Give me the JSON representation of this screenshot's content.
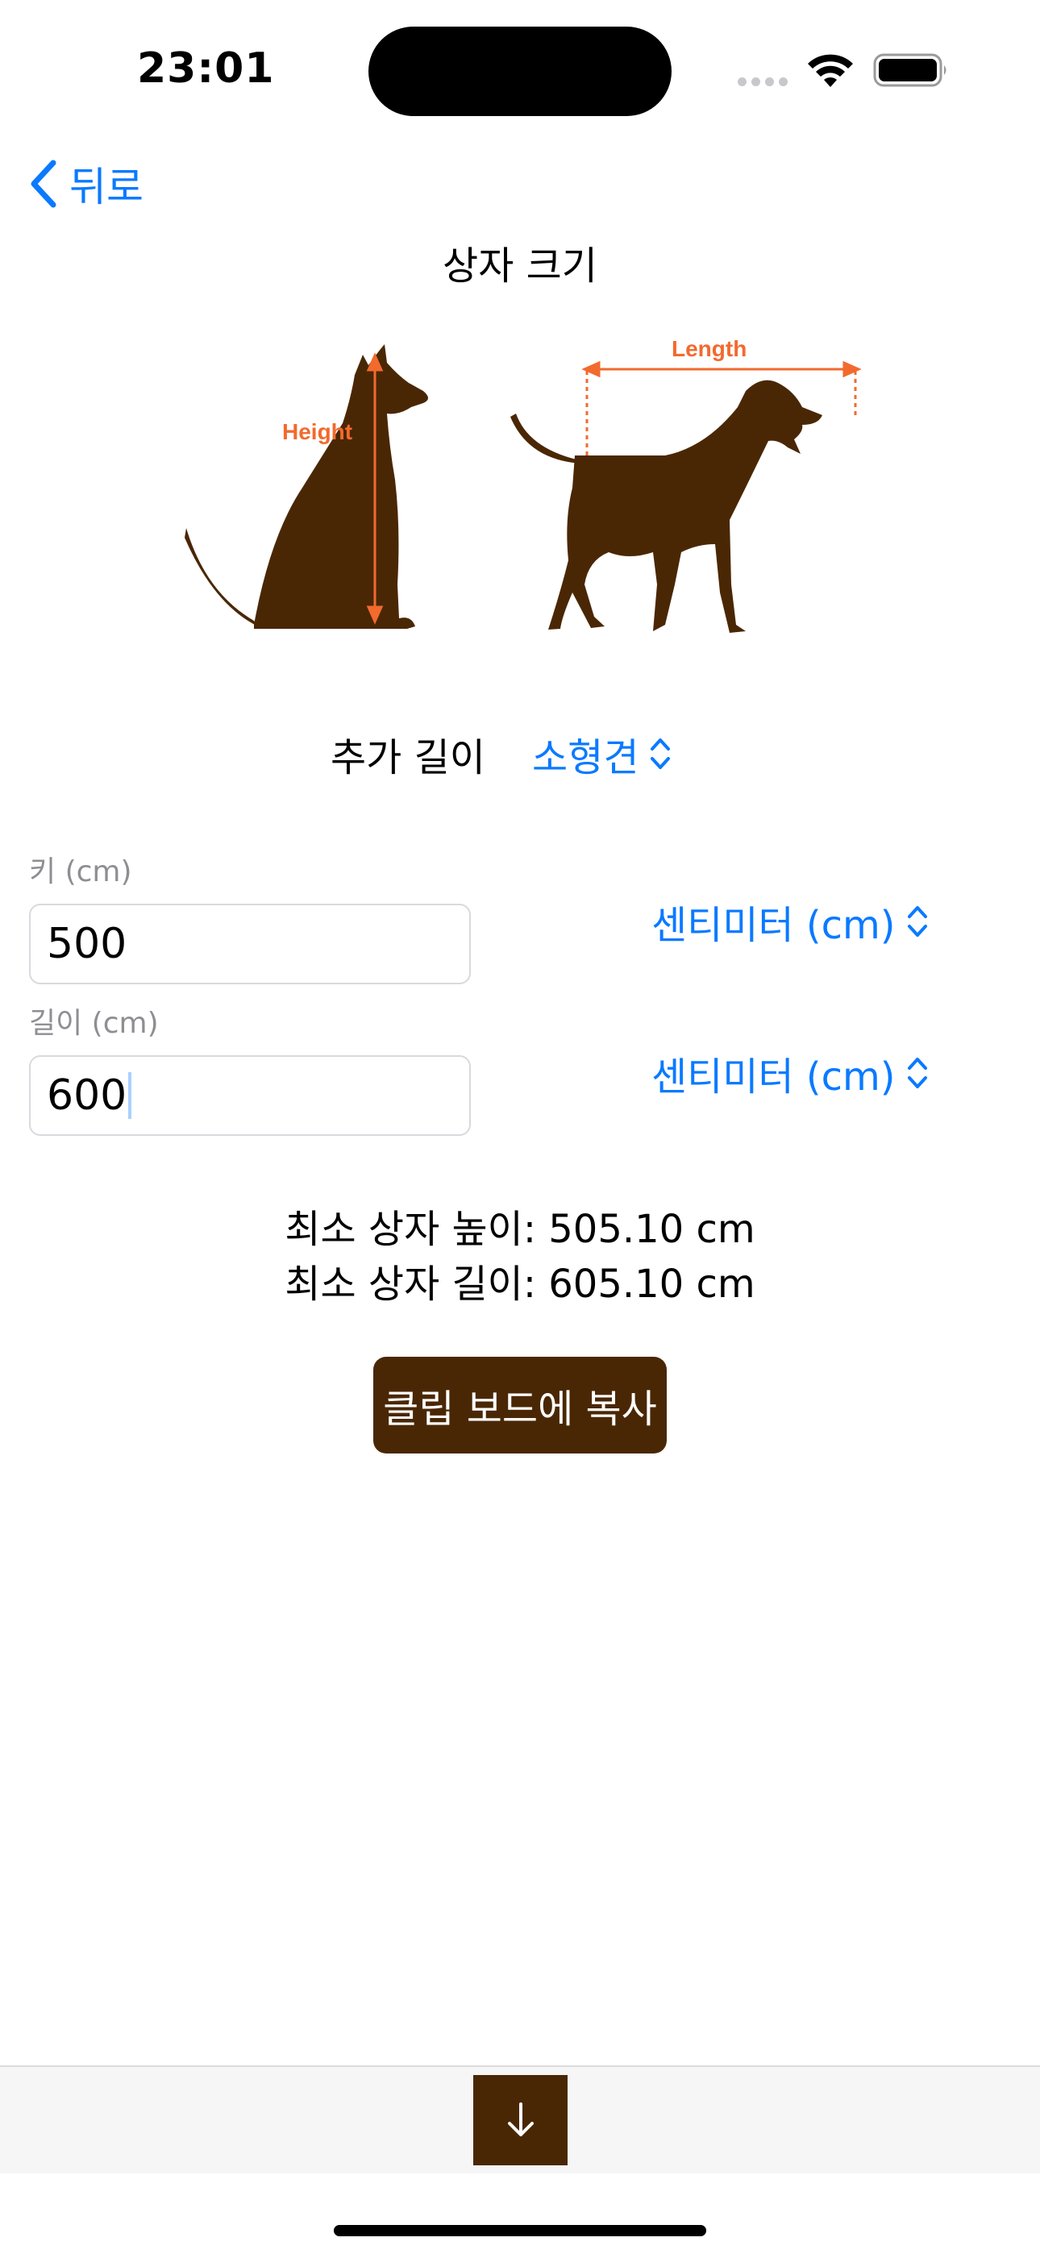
{
  "status_bar": {
    "time": "23:01"
  },
  "nav": {
    "back_label": "뒤로",
    "title": "상자 크기"
  },
  "illustration": {
    "height_label": "Height",
    "length_label": "Length",
    "silhouette_color": "#4a2704",
    "accent_color": "#f26a2e"
  },
  "breed": {
    "label": "추가 길이",
    "selected": "소형견"
  },
  "height_field": {
    "label": "키 (cm)",
    "value": "500",
    "unit": "센티미터 (cm)"
  },
  "length_field": {
    "label": "길이 (cm)",
    "value": "600",
    "unit": "센티미터 (cm)"
  },
  "results": {
    "min_height": "최소 상자 높이: 505.10 cm",
    "min_length": "최소 상자 길이: 605.10 cm"
  },
  "copy_button": {
    "label": "클립 보드에 복사"
  },
  "colors": {
    "accent": "#0a7aff",
    "brand": "#4a2704"
  },
  "bottom_bar": {
    "down_icon": "arrow-down-icon"
  }
}
